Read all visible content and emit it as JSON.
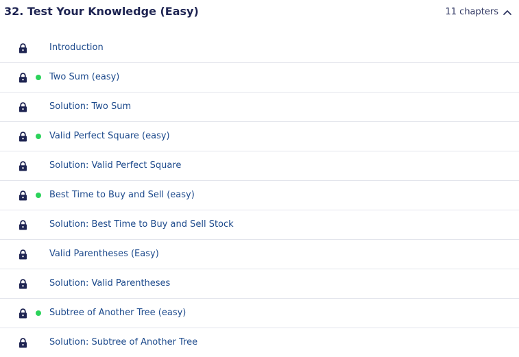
{
  "section": {
    "title": "32.  Test Your Knowledge (Easy)",
    "chapter_count": "11 chapters",
    "expanded": true,
    "toggle_icon": "chevron-up-icon"
  },
  "colors": {
    "title": "#1e2452",
    "link": "#1d4a8c",
    "lock": "#1e2452",
    "status_dot": "#2bd35a",
    "divider": "#e3e5ec"
  },
  "chapters": [
    {
      "label": "Introduction",
      "locked": true,
      "marked": false
    },
    {
      "label": "Two Sum (easy)",
      "locked": true,
      "marked": true
    },
    {
      "label": "Solution: Two Sum",
      "locked": true,
      "marked": false
    },
    {
      "label": "Valid Perfect Square (easy)",
      "locked": true,
      "marked": true
    },
    {
      "label": "Solution: Valid Perfect Square",
      "locked": true,
      "marked": false
    },
    {
      "label": "Best Time to Buy and Sell (easy)",
      "locked": true,
      "marked": true
    },
    {
      "label": "Solution: Best Time to Buy and Sell Stock",
      "locked": true,
      "marked": false
    },
    {
      "label": "Valid Parentheses (Easy)",
      "locked": true,
      "marked": false
    },
    {
      "label": "Solution: Valid Parentheses",
      "locked": true,
      "marked": false
    },
    {
      "label": "Subtree of Another Tree (easy)",
      "locked": true,
      "marked": true
    },
    {
      "label": "Solution: Subtree of Another Tree",
      "locked": true,
      "marked": false
    }
  ]
}
